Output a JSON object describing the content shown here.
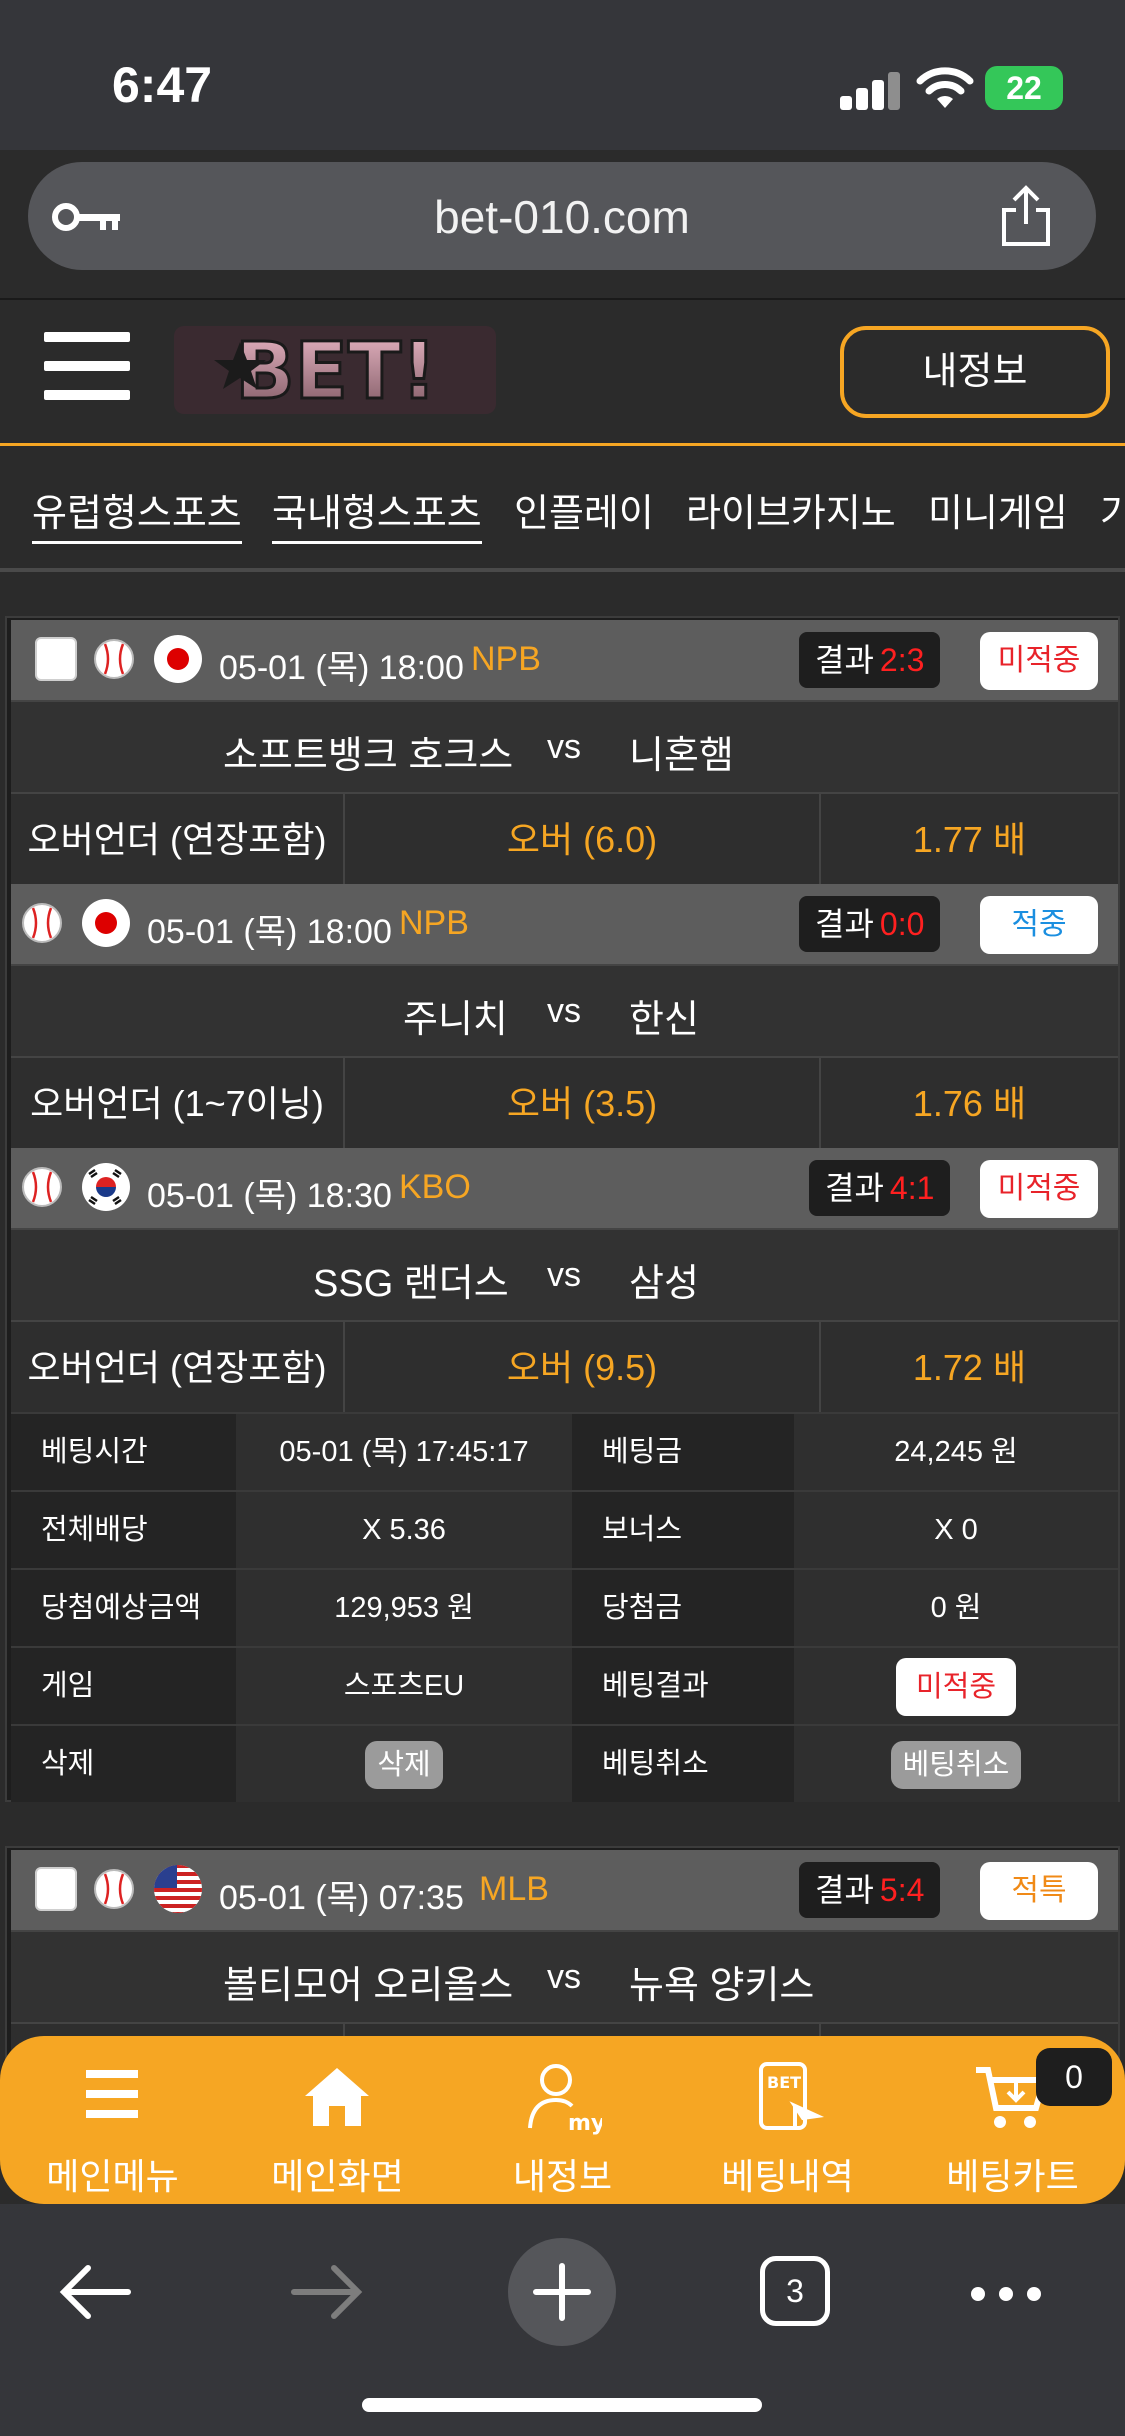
{
  "status_bar": {
    "time": "6:47",
    "battery": "22"
  },
  "browser": {
    "url": "bet-010.com",
    "tab_count": "3"
  },
  "header": {
    "myinfo_button": "내정보",
    "logo_text": "BET!"
  },
  "nav_tabs": [
    "유럽형스포츠",
    "국내형스포츠",
    "인플레이",
    "라이브카지노",
    "미니게임",
    "가"
  ],
  "bet_slip_1": {
    "games": [
      {
        "datetime": "05-01 (목) 18:00",
        "league": "NPB",
        "flag": "japan",
        "result_label": "결과",
        "score": "2:3",
        "status": "미적중",
        "home": "소프트뱅크 호크스",
        "vs": "vs",
        "away": "니혼햄",
        "market": "오버언더 (연장포함)",
        "pick": "오버 (6.0)",
        "odds": "1.77 배"
      },
      {
        "datetime": "05-01 (목) 18:00",
        "league": "NPB",
        "flag": "japan",
        "result_label": "결과",
        "score": "0:0",
        "status": "적중",
        "home": "주니치",
        "vs": "vs",
        "away": "한신",
        "market": "오버언더 (1~7이닝)",
        "pick": "오버 (3.5)",
        "odds": "1.76 배"
      },
      {
        "datetime": "05-01 (목) 18:30",
        "league": "KBO",
        "flag": "korea",
        "result_label": "결과",
        "score": "4:1",
        "status": "미적중",
        "home": "SSG 랜더스",
        "vs": "vs",
        "away": "삼성",
        "market": "오버언더 (연장포함)",
        "pick": "오버 (9.5)",
        "odds": "1.72 배"
      }
    ],
    "summary": {
      "bet_time_label": "베팅시간",
      "bet_time": "05-01 (목) 17:45:17",
      "bet_amount_label": "베팅금",
      "bet_amount": "24,245 원",
      "total_odds_label": "전체배당",
      "total_odds": "X 5.36",
      "bonus_label": "보너스",
      "bonus": "X 0",
      "expected_label": "당첨예상금액",
      "expected": "129,953 원",
      "winnings_label": "당첨금",
      "winnings": "0 원",
      "game_label": "게임",
      "game": "스포츠EU",
      "result_label": "베팅결과",
      "result": "미적중",
      "delete_label": "삭제",
      "delete_button": "삭제",
      "cancel_label": "베팅취소",
      "cancel_button": "베팅취소"
    }
  },
  "bet_slip_2": {
    "game": {
      "datetime": "05-01 (목) 07:35",
      "league": "MLB",
      "flag": "usa",
      "result_label": "결과",
      "score": "5:4",
      "status": "적특",
      "home": "볼티모어 오리올스",
      "vs": "vs",
      "away": "뉴욕 양키스"
    }
  },
  "bottom_nav": [
    {
      "label": "메인메뉴",
      "icon": "menu-icon"
    },
    {
      "label": "메인화면",
      "icon": "home-icon"
    },
    {
      "label": "내정보",
      "icon": "my-icon"
    },
    {
      "label": "베팅내역",
      "icon": "bet-history-icon"
    },
    {
      "label": "베팅카트",
      "icon": "cart-icon"
    }
  ],
  "cart_count": "0",
  "colors": {
    "accent": "#f6a623",
    "miss": "#e8232a",
    "hit": "#1b8fe0",
    "score": "#ff2020"
  }
}
